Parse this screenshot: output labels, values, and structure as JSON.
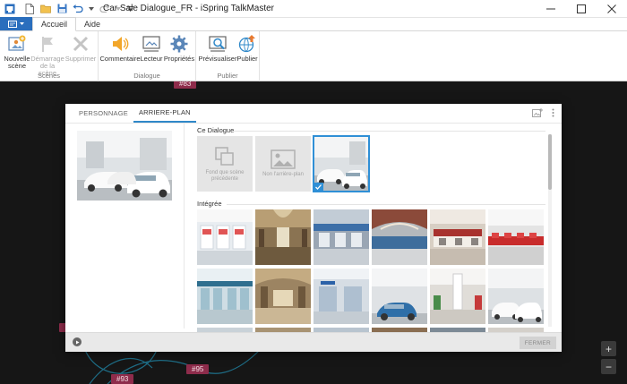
{
  "window": {
    "title": "Car Sale Dialogue_FR - iSpring TalkMaster",
    "controls": [
      "minimize",
      "maximize",
      "close"
    ]
  },
  "ribbon": {
    "tabs": [
      {
        "label": "Accueil",
        "active": true
      },
      {
        "label": "Aide",
        "active": false
      }
    ],
    "groups": {
      "scenes": {
        "label": "Scènes",
        "buttons": [
          {
            "label1": "Nouvelle",
            "label2": "scène",
            "icon": "new-scene-icon",
            "enabled": true
          },
          {
            "label1": "Démarrage",
            "label2": "de la scène",
            "icon": "flag-icon",
            "enabled": false
          },
          {
            "label1": "Supprimer",
            "label2": "",
            "icon": "delete-icon",
            "enabled": false
          }
        ]
      },
      "dialogue": {
        "label": "Dialogue",
        "buttons": [
          {
            "label": "Commentaire",
            "icon": "speaker-icon"
          },
          {
            "label": "Lecteur",
            "icon": "player-icon"
          },
          {
            "label": "Propriétés",
            "icon": "gear-icon"
          }
        ]
      },
      "publier": {
        "label": "Publier",
        "buttons": [
          {
            "label": "Prévisualiser",
            "icon": "preview-icon"
          },
          {
            "label": "Publier",
            "icon": "publish-icon"
          }
        ]
      }
    }
  },
  "canvas": {
    "nodes": [
      "#83",
      "#95",
      "#93"
    ],
    "zoom_in": "+",
    "zoom_out": "−"
  },
  "dialog": {
    "tabs": [
      {
        "label": "PERSONNAGE",
        "active": false
      },
      {
        "label": "ARRIERE-PLAN",
        "active": true
      }
    ],
    "sections": {
      "current": {
        "title": "Ce Dialogue",
        "options": [
          {
            "label": "Fond que scène précédente",
            "icon": "copy-icon"
          },
          {
            "label": "Non l'arrière-plan",
            "icon": "image-icon"
          }
        ]
      },
      "builtin": {
        "title": "Intégrée"
      }
    },
    "footer": {
      "close_label": "FERMER"
    }
  },
  "colors": {
    "accent": "#2f88c8",
    "canvas_bg": "#161616",
    "node": "#8e2c4b",
    "file_tab": "#2a6ebd"
  }
}
